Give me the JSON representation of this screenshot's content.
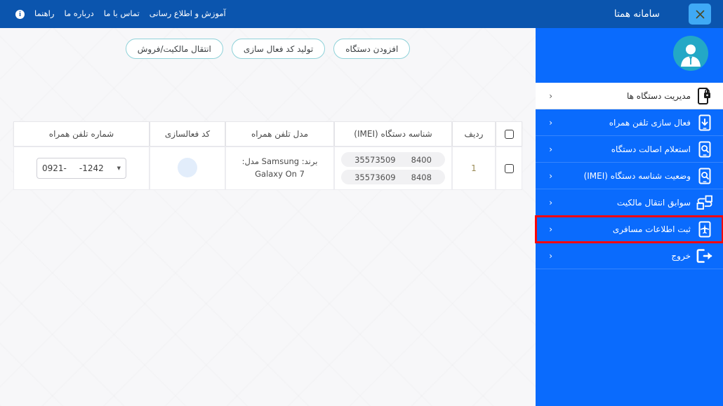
{
  "window": {
    "title": "سامانه همتا",
    "close_label": "×"
  },
  "topnav": {
    "items": [
      {
        "label": "آموزش و اطلاع رسانی",
        "icon": ""
      },
      {
        "label": "تماس با ما",
        "icon": ""
      },
      {
        "label": "درباره ما",
        "icon": ""
      },
      {
        "label": "راهنما",
        "icon": "info-icon"
      }
    ],
    "info_glyph": "i"
  },
  "sidebar": {
    "avatar_icon": "user-avatar-icon",
    "chevron": "‹",
    "items": [
      {
        "label": "مدیریت دستگاه ها",
        "icon": "phone-lock-icon",
        "active": true,
        "highlighted": false
      },
      {
        "label": "فعال سازی تلفن همراه",
        "icon": "phone-download-icon",
        "active": false,
        "highlighted": false
      },
      {
        "label": "استعلام اصالت دستگاه",
        "icon": "phone-search-icon",
        "active": false,
        "highlighted": false
      },
      {
        "label": "وضعیت شناسه دستگاه (IMEI)",
        "icon": "phone-search-icon",
        "active": false,
        "highlighted": false
      },
      {
        "label": "سوابق انتقال مالکیت",
        "icon": "transfer-icon",
        "active": false,
        "highlighted": false
      },
      {
        "label": "ثبت اطلاعات مسافری",
        "icon": "phone-airplane-icon",
        "active": false,
        "highlighted": true
      },
      {
        "label": "خروج",
        "icon": "logout-icon",
        "active": false,
        "highlighted": false
      }
    ]
  },
  "actions": {
    "buttons": [
      {
        "label": "افزودن دستگاه"
      },
      {
        "label": "تولید کد فعال سازی"
      },
      {
        "label": "انتقال مالکیت/فروش"
      }
    ]
  },
  "table": {
    "headers": {
      "select_all": "",
      "row": "ردیف",
      "imei": "شناسه دستگاه (IMEI)",
      "model": "مدل تلفن همراه",
      "code": "کد فعالسازی",
      "phone": "شماره تلفن همراه"
    },
    "rows": [
      {
        "row_number": "1",
        "imei": [
          {
            "left": "35573509",
            "right": "8400"
          },
          {
            "left": "35573609",
            "right": "8408"
          }
        ],
        "model_line1": "برند: Samsung مدل:",
        "model_line2": "Galaxy On 7",
        "code_state": "loading",
        "phone_prefix": "0921-",
        "phone_suffix": "-1242",
        "phone_caret": "▼"
      }
    ]
  },
  "colors": {
    "topbar": "#0b55ae",
    "sidebar": "#0a6bfd",
    "close_button": "#3fa9f5",
    "avatar": "#23a8c6",
    "highlight_border": "#fd0606",
    "pill_border": "#90d2d9",
    "content_bg": "#f7f7f9"
  }
}
